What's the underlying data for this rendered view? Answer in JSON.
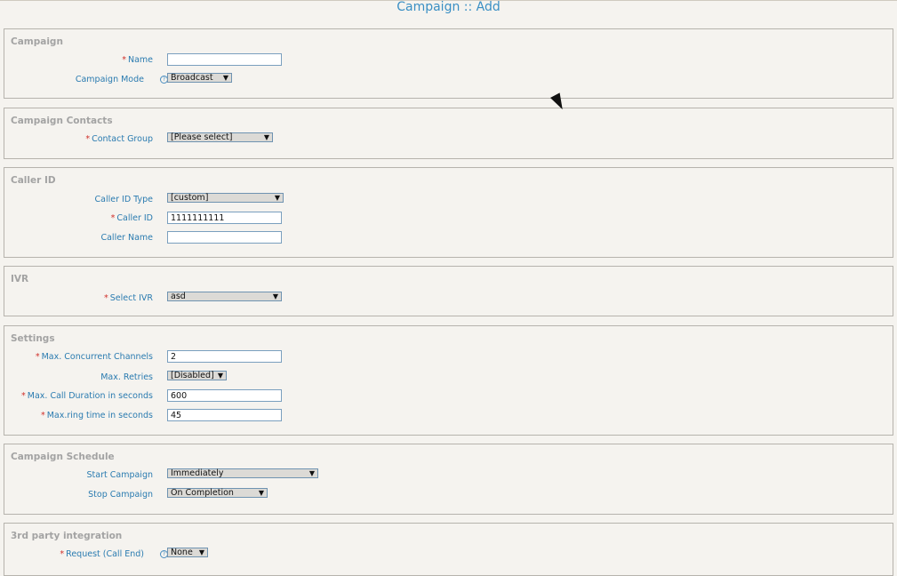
{
  "page": {
    "title": "Campaign :: Add"
  },
  "sections": {
    "campaign": {
      "legend": "Campaign",
      "name_label": "Name",
      "name_value": "",
      "mode_label": "Campaign Mode",
      "mode_value": "Broadcast"
    },
    "contacts": {
      "legend": "Campaign Contacts",
      "group_label": "Contact Group",
      "group_value": "[Please select]"
    },
    "callerid": {
      "legend": "Caller ID",
      "type_label": "Caller ID Type",
      "type_value": "[custom]",
      "id_label": "Caller ID",
      "id_value": "1111111111",
      "name_label": "Caller Name",
      "name_value": ""
    },
    "ivr": {
      "legend": "IVR",
      "select_label": "Select IVR",
      "select_value": "asd"
    },
    "settings": {
      "legend": "Settings",
      "channels_label": "Max. Concurrent Channels",
      "channels_value": "2",
      "retries_label": "Max. Retries",
      "retries_value": "[Disabled]",
      "duration_label": "Max. Call Duration in seconds",
      "duration_value": "600",
      "ring_label": "Max.ring time in seconds",
      "ring_value": "45"
    },
    "schedule": {
      "legend": "Campaign Schedule",
      "start_label": "Start Campaign",
      "start_value": "Immediately",
      "stop_label": "Stop Campaign",
      "stop_value": "On Completion"
    },
    "integration": {
      "legend": "3rd party integration",
      "request_label": "Request (Call End)",
      "request_value": "None"
    }
  },
  "glyphs": {
    "required": "*",
    "help": "?",
    "dropdown": "▼"
  }
}
